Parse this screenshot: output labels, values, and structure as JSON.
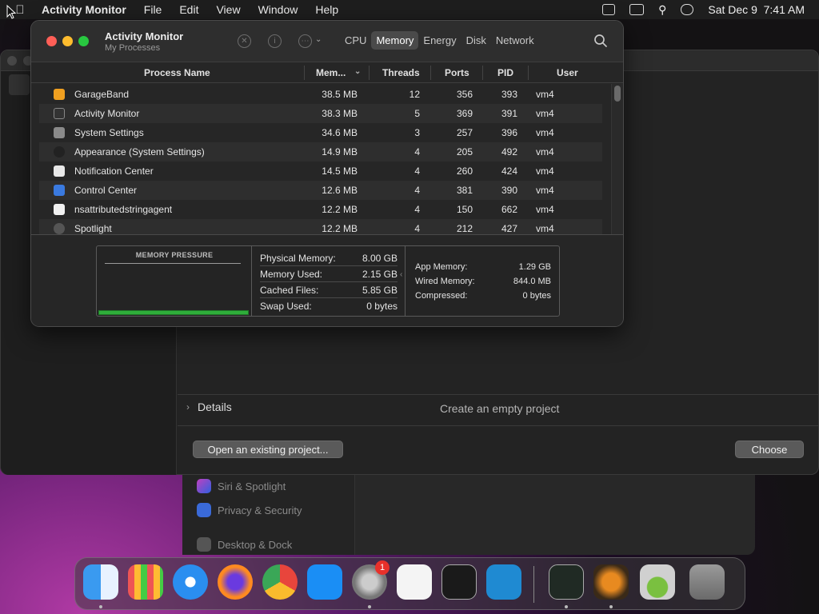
{
  "menubar": {
    "app_name": "Activity Monitor",
    "menus": [
      "File",
      "Edit",
      "View",
      "Window",
      "Help"
    ],
    "clock": "Sat Dec 9  7:41 AM"
  },
  "settings_bg": {
    "items": [
      "Siri & Spotlight",
      "Privacy & Security",
      "Desktop & Dock"
    ]
  },
  "garageband": {
    "details_label": "Details",
    "description": "Create an empty project",
    "open_button": "Open an existing project...",
    "choose_button": "Choose"
  },
  "activity_monitor": {
    "title": "Activity Monitor",
    "subtitle": "My Processes",
    "tabs": [
      "CPU",
      "Memory",
      "Energy",
      "Disk",
      "Network"
    ],
    "active_tab": "Memory",
    "columns": {
      "process_name": "Process Name",
      "memory": "Mem...",
      "threads": "Threads",
      "ports": "Ports",
      "pid": "PID",
      "user": "User"
    },
    "rows": [
      {
        "name": "GarageBand",
        "mem": "38.5 MB",
        "threads": "12",
        "ports": "356",
        "pid": "393",
        "user": "vm4",
        "icon": "garageband-icon"
      },
      {
        "name": "Activity Monitor",
        "mem": "38.3 MB",
        "threads": "5",
        "ports": "369",
        "pid": "391",
        "user": "vm4",
        "icon": "activity-monitor-icon"
      },
      {
        "name": "System Settings",
        "mem": "34.6 MB",
        "threads": "3",
        "ports": "257",
        "pid": "396",
        "user": "vm4",
        "icon": "gear-icon"
      },
      {
        "name": "Appearance (System Settings)",
        "mem": "14.9 MB",
        "threads": "4",
        "ports": "205",
        "pid": "492",
        "user": "vm4",
        "icon": "appearance-icon"
      },
      {
        "name": "Notification Center",
        "mem": "14.5 MB",
        "threads": "4",
        "ports": "260",
        "pid": "424",
        "user": "vm4",
        "icon": "notification-icon"
      },
      {
        "name": "Control Center",
        "mem": "12.6 MB",
        "threads": "4",
        "ports": "381",
        "pid": "390",
        "user": "vm4",
        "icon": "control-center-icon"
      },
      {
        "name": "nsattributedstringagent",
        "mem": "12.2 MB",
        "threads": "4",
        "ports": "150",
        "pid": "662",
        "user": "vm4",
        "icon": "shield-icon"
      },
      {
        "name": "Spotlight",
        "mem": "12.2 MB",
        "threads": "4",
        "ports": "212",
        "pid": "427",
        "user": "vm4",
        "icon": "search-icon"
      }
    ],
    "memory_pressure": {
      "label": "MEMORY PRESSURE",
      "level": 0.05,
      "color": "#2fae3a"
    },
    "stats": {
      "physical_memory_label": "Physical Memory:",
      "physical_memory": "8.00 GB",
      "memory_used_label": "Memory Used:",
      "memory_used": "2.15 GB",
      "cached_files_label": "Cached Files:",
      "cached_files": "5.85 GB",
      "swap_used_label": "Swap Used:",
      "swap_used": "0 bytes",
      "app_memory_label": "App Memory:",
      "app_memory": "1.29 GB",
      "wired_memory_label": "Wired Memory:",
      "wired_memory": "844.0 MB",
      "compressed_label": "Compressed:",
      "compressed": "0 bytes"
    }
  },
  "dock": {
    "apps": [
      "finder-icon",
      "launchpad-icon",
      "safari-icon",
      "firefox-icon",
      "chrome-icon",
      "app-store-icon",
      "system-settings-icon",
      "textedit-icon",
      "terminal-icon",
      "vscode-icon",
      "activity-monitor-icon",
      "garageband-icon",
      "disk-utility-icon",
      "trash-icon"
    ],
    "settings_badge": "1"
  }
}
